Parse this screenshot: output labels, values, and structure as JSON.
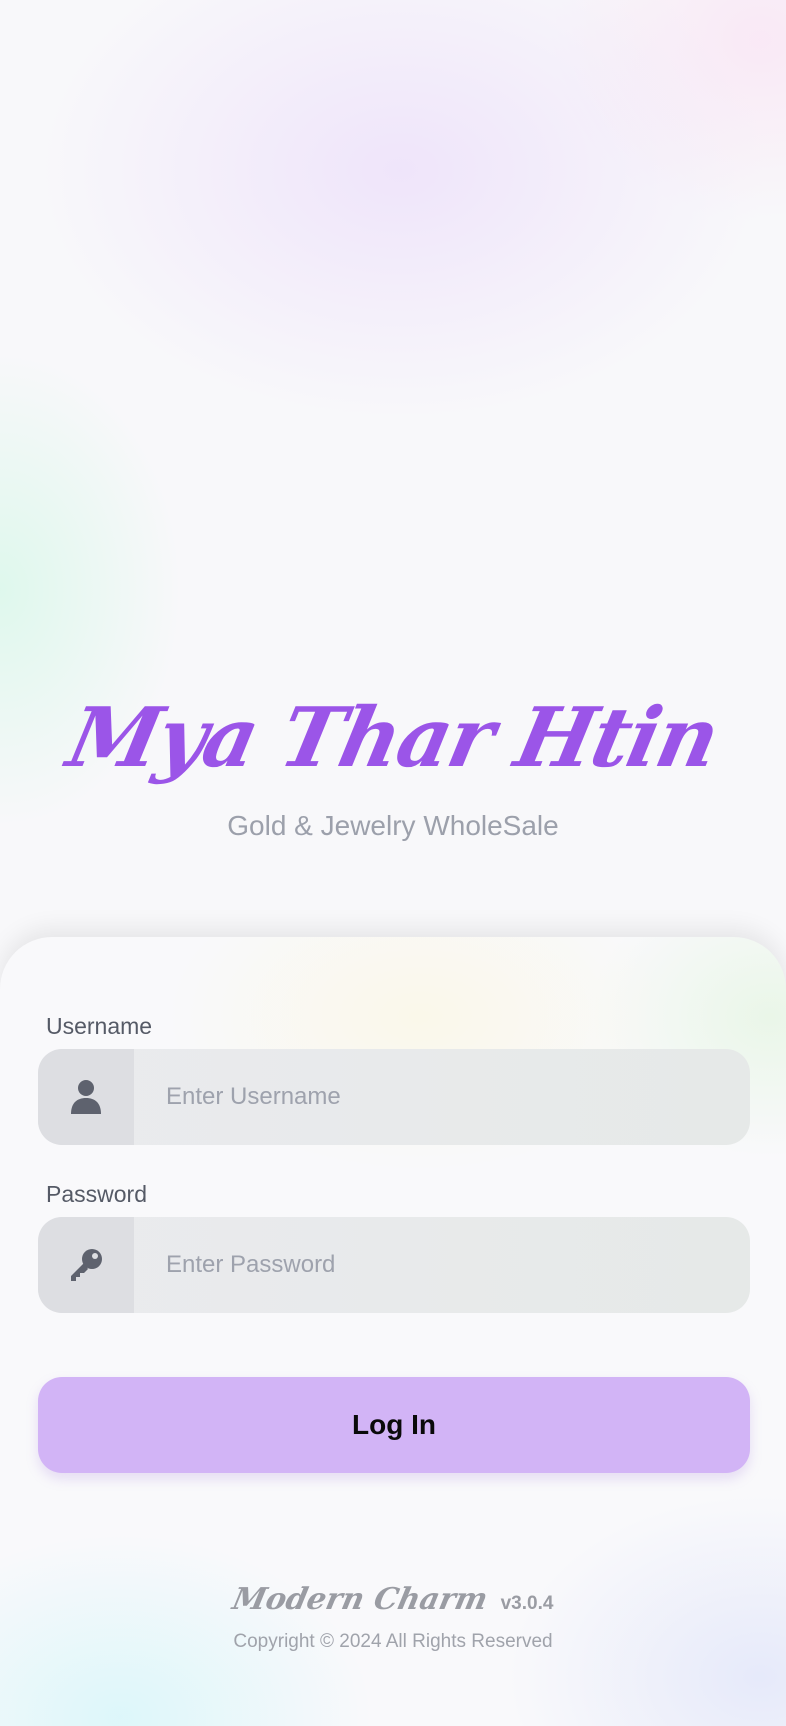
{
  "brand": {
    "title": "Mya Thar Htin",
    "subtitle": "Gold & Jewelry WholeSale"
  },
  "form": {
    "username": {
      "label": "Username",
      "placeholder": "Enter Username",
      "value": "",
      "icon": "user-icon"
    },
    "password": {
      "label": "Password",
      "placeholder": "Enter Password",
      "value": "",
      "icon": "key-icon"
    },
    "login_label": "Log In"
  },
  "footer": {
    "brand": "Modern Charm",
    "version": "v3.0.4",
    "copyright": "Copyright © 2024 All Rights Reserved"
  },
  "colors": {
    "accent": "#9b55e8",
    "button": "#d2b4f6",
    "label": "#555a66",
    "muted": "#9ca0ab"
  }
}
